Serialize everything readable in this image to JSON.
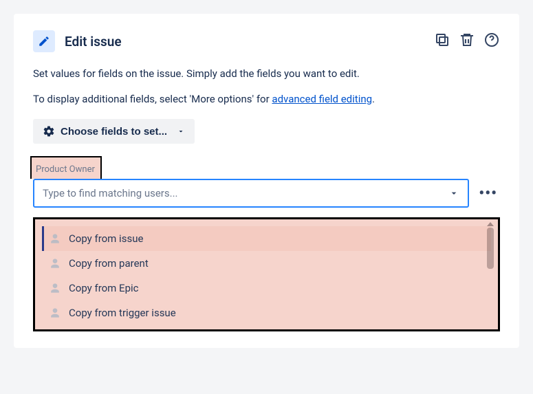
{
  "header": {
    "title": "Edit issue"
  },
  "description": {
    "line1": "Set values for fields on the issue. Simply add the fields you want to edit.",
    "line2_prefix": "To display additional fields, select 'More options' for ",
    "line2_link": "advanced field editing",
    "line2_suffix": "."
  },
  "choose_button": "Choose fields to set...",
  "field": {
    "label": "Product Owner",
    "placeholder": "Type to find matching users..."
  },
  "more_label": "•••",
  "dropdown": [
    {
      "label": "Copy from issue"
    },
    {
      "label": "Copy from parent"
    },
    {
      "label": "Copy from Epic"
    },
    {
      "label": "Copy from trigger issue"
    }
  ]
}
